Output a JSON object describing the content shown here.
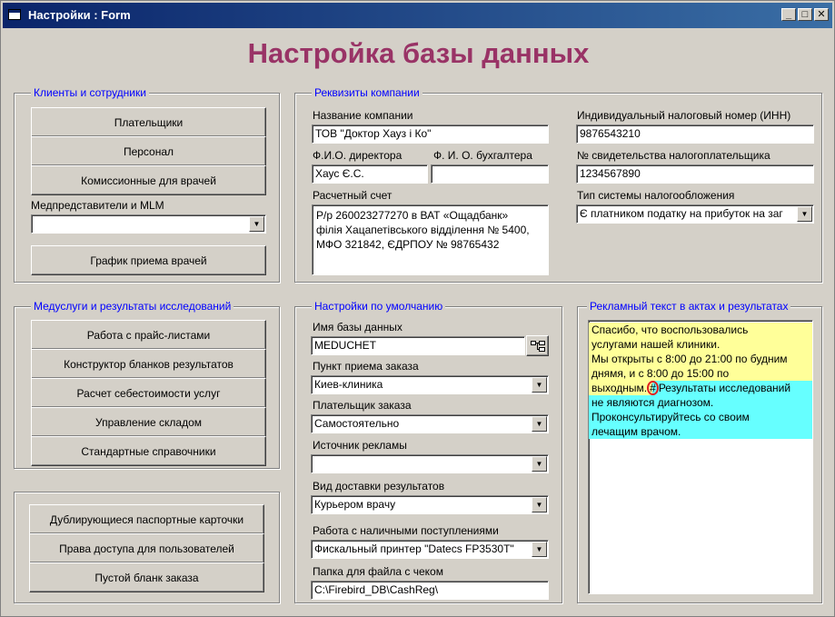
{
  "window": {
    "title": "Настройки : Form",
    "minimize": "_",
    "maximize": "□",
    "close": "✕"
  },
  "header": {
    "caption": "Настройка базы данных"
  },
  "clients": {
    "label": "Клиенты и сотрудники",
    "btn_payers": "Плательщики",
    "btn_staff": "Персонал",
    "btn_commission": "Комиссионные для врачей",
    "medreps_label": "Медпредставители и MLM",
    "medreps_value": "",
    "btn_schedule": "График приема врачей"
  },
  "company": {
    "label": "Реквизиты компании",
    "name_label": "Название компании",
    "name_value": "ТОВ \"Доктор Хауз і Ко\"",
    "inn_label": "Индивидуальный налоговый номер (ИНН)",
    "inn_value": "9876543210",
    "director_label": "Ф.И.О. директора",
    "director_value": "Хаус Є.С.",
    "accountant_label": "Ф. И. О. бухгалтера",
    "accountant_value": "",
    "cert_label": "№ свидетельства налогоплательщика",
    "cert_value": "1234567890",
    "account_label": "Расчетный счет",
    "account_lines": [
      "Р/р 260023277270 в ВАТ «Ощадбанк»",
      "філія Хацапетівського відділення № 5400,",
      "МФО 321842, ЄДРПОУ № 98765432"
    ],
    "tax_label": "Тип системы налогообложения",
    "tax_value": "Є платником податку на прибуток на заг"
  },
  "medservices": {
    "label": "Медуслуги и результаты исследований",
    "btn_pricelists": "Работа с прайс-листами",
    "btn_forms": "Конструктор бланков результатов",
    "btn_cost": "Расчет себестоимости услуг",
    "btn_warehouse": "Управление складом",
    "btn_refs": "Стандартные справочники"
  },
  "misc": {
    "btn_duplicates": "Дублирующиеся паспортные карточки",
    "btn_rights": "Права доступа для пользователей",
    "btn_blank": "Пустой бланк заказа"
  },
  "defaults": {
    "label": "Настройки по умолчанию",
    "db_label": "Имя базы данных",
    "db_value": "MEDUCHET",
    "point_label": "Пункт приема заказа",
    "point_value": "Киев-клиника",
    "payer_label": "Плательщик заказа",
    "payer_value": "Самостоятельно",
    "adsource_label": "Источник рекламы",
    "adsource_value": "",
    "delivery_label": "Вид доставки результатов",
    "delivery_value": "Курьером врачу",
    "cash_label": "Работа с наличными поступлениями",
    "cash_value": "Фискальный принтер \"Datecs FP3530T\"",
    "folder_label": "Папка для файла с чеком",
    "folder_value": "C:\\Firebird_DB\\CashReg\\"
  },
  "ad": {
    "label": "Рекламный текст в актах и результатах",
    "yellow_lines": [
      "Спасибо, что воспользовались",
      "услугами нашей клиники.",
      "Мы открыты с 8:00 до 21:00 по будним",
      "днямя, и с 8:00 до 15:00 по"
    ],
    "pre_hash": "выходным.",
    "hash": "#",
    "post_hash": "Результаты исследований",
    "cyan_lines": [
      "не являются диагнозом.",
      "Проконсультируйтесь со своим",
      "лечащим врачом."
    ]
  },
  "colors": {
    "title_caption": "#993366",
    "group_label": "#0000ff",
    "highlight_yellow": "#ffff99",
    "highlight_cyan": "#66ffff"
  }
}
